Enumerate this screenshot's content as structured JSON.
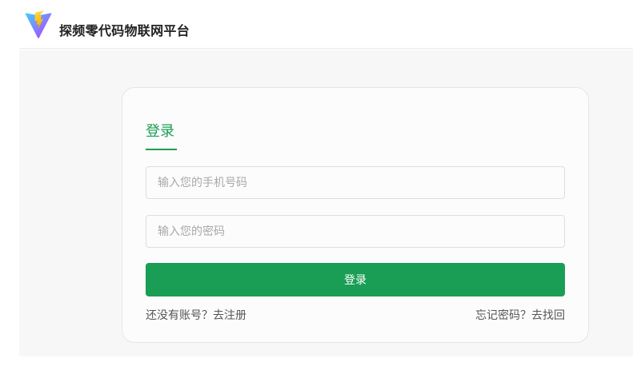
{
  "header": {
    "logo_icon": "vite-lightning-logo-icon",
    "title": "探频零代码物联网平台"
  },
  "login": {
    "title": "登录",
    "phone_placeholder": "输入您的手机号码",
    "password_placeholder": "输入您的密码",
    "submit_label": "登录",
    "register_link": "还没有账号？去注册",
    "forgot_link": "忘记密码？去找回"
  },
  "colors": {
    "accent": "#1a9e55",
    "logo_purple": "#7b3fe4",
    "logo_yellow": "#ffc517"
  }
}
